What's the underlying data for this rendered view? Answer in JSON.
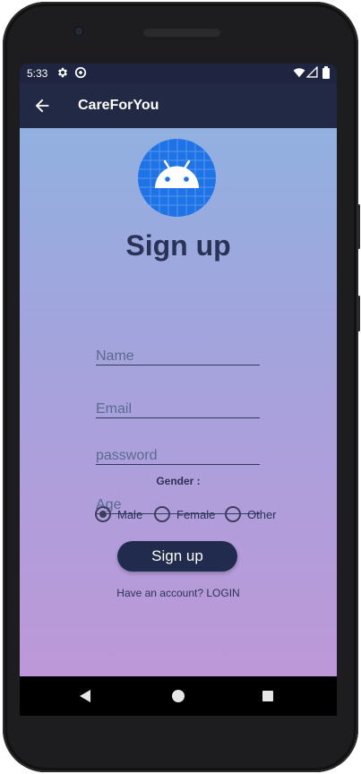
{
  "status_bar": {
    "time": "5:33",
    "icons": [
      "gear-icon",
      "sync-icon",
      "wifi-icon",
      "signal-icon",
      "battery-icon"
    ]
  },
  "app_bar": {
    "title": "CareForYou",
    "back_icon": "arrow-left-icon"
  },
  "form": {
    "heading": "Sign up",
    "fields": {
      "name": {
        "placeholder": "Name",
        "value": ""
      },
      "email": {
        "placeholder": "Email",
        "value": ""
      },
      "password": {
        "placeholder": "password",
        "value": ""
      },
      "age": {
        "placeholder": "Age",
        "value": ""
      }
    },
    "gender_label": "Gender :",
    "gender_options": [
      {
        "label": "Male",
        "checked": true
      },
      {
        "label": "Female",
        "checked": false
      },
      {
        "label": "Other",
        "checked": false
      }
    ],
    "submit_label": "Sign up",
    "login_prompt": "Have an account? LOGIN"
  },
  "nav_bar": {
    "icons": [
      "back-triangle-icon",
      "home-circle-icon",
      "recents-square-icon"
    ]
  },
  "colors": {
    "app_bar": "#222944",
    "gradient_top": "#91b0e0",
    "gradient_bottom": "#bd98d8",
    "button": "#202b4d",
    "logo_bg": "#1e73e6"
  }
}
